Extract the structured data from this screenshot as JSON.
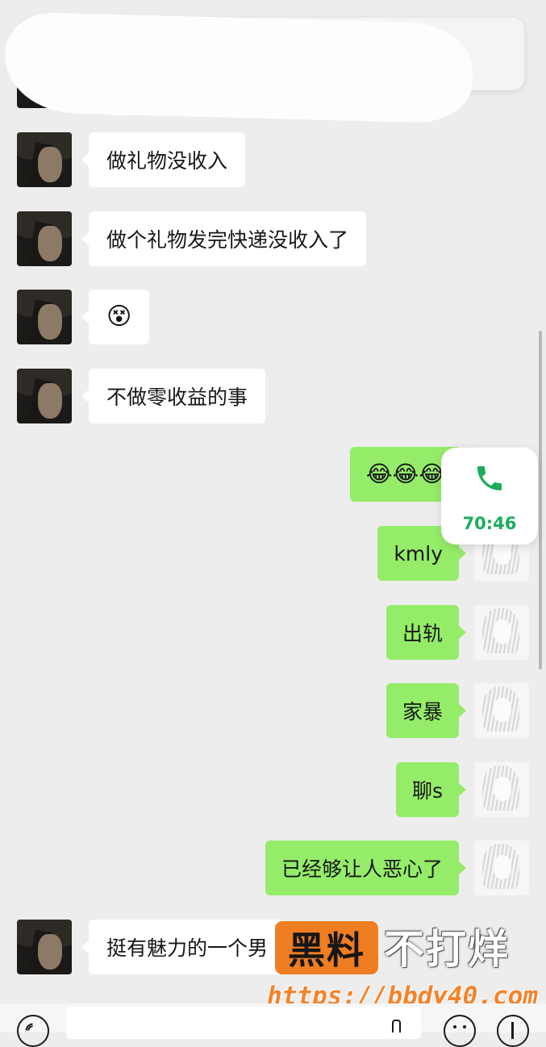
{
  "messages": [
    {
      "side": "left",
      "type": "text",
      "text": "做礼物没收入"
    },
    {
      "side": "left",
      "type": "text",
      "text": "做个礼物发完快递没收入了"
    },
    {
      "side": "left",
      "type": "emoji",
      "text": "😵"
    },
    {
      "side": "left",
      "type": "text",
      "text": "不做零收益的事"
    },
    {
      "side": "right",
      "type": "emoji",
      "text": "😂😂😂"
    },
    {
      "side": "right",
      "type": "text",
      "text": "kmly"
    },
    {
      "side": "right",
      "type": "text",
      "text": "出轨"
    },
    {
      "side": "right",
      "type": "text",
      "text": "家暴"
    },
    {
      "side": "right",
      "type": "text",
      "text": "聊s"
    },
    {
      "side": "right",
      "type": "text",
      "text": "已经够让人恶心了"
    },
    {
      "side": "left",
      "type": "text",
      "text": "挺有魅力的一个男"
    }
  ],
  "call_card": {
    "duration": "70:46",
    "icon": "phone-icon",
    "color": "#1aad5c"
  },
  "watermark": {
    "tag": "黑料",
    "text": "不打烊",
    "url": "https://bbdy40.com"
  },
  "input_bar": {
    "left_icon": "voice-icon",
    "right_icons": [
      "emoji-icon",
      "plus-icon"
    ]
  },
  "colors": {
    "background": "#ededed",
    "received_bubble": "#ffffff",
    "sent_bubble": "#95ec69",
    "accent": "#ef7d22"
  }
}
